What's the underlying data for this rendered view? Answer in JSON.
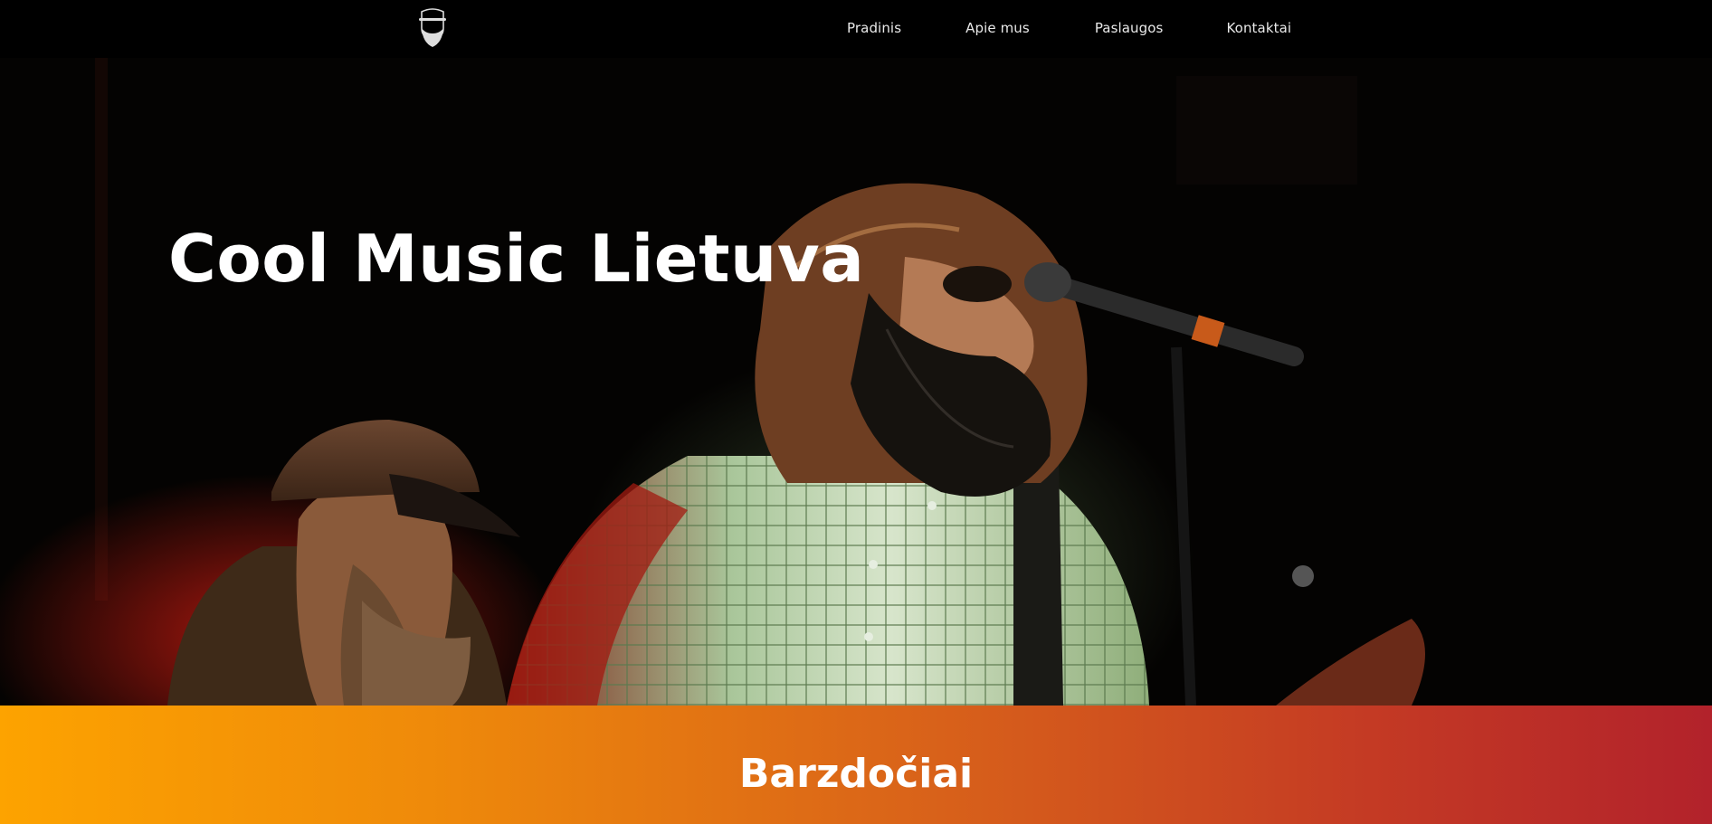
{
  "nav": {
    "items": [
      {
        "label": "Pradinis"
      },
      {
        "label": "Apie mus"
      },
      {
        "label": "Paslaugos"
      },
      {
        "label": "Kontaktai"
      }
    ]
  },
  "hero": {
    "title": "Cool Music Lietuva"
  },
  "band": {
    "title": "Barzdočiai"
  },
  "colors": {
    "nav_bg": "#000000",
    "band_gradient_start": "#fda300",
    "band_gradient_end": "#b2222b",
    "text": "#ffffff"
  }
}
